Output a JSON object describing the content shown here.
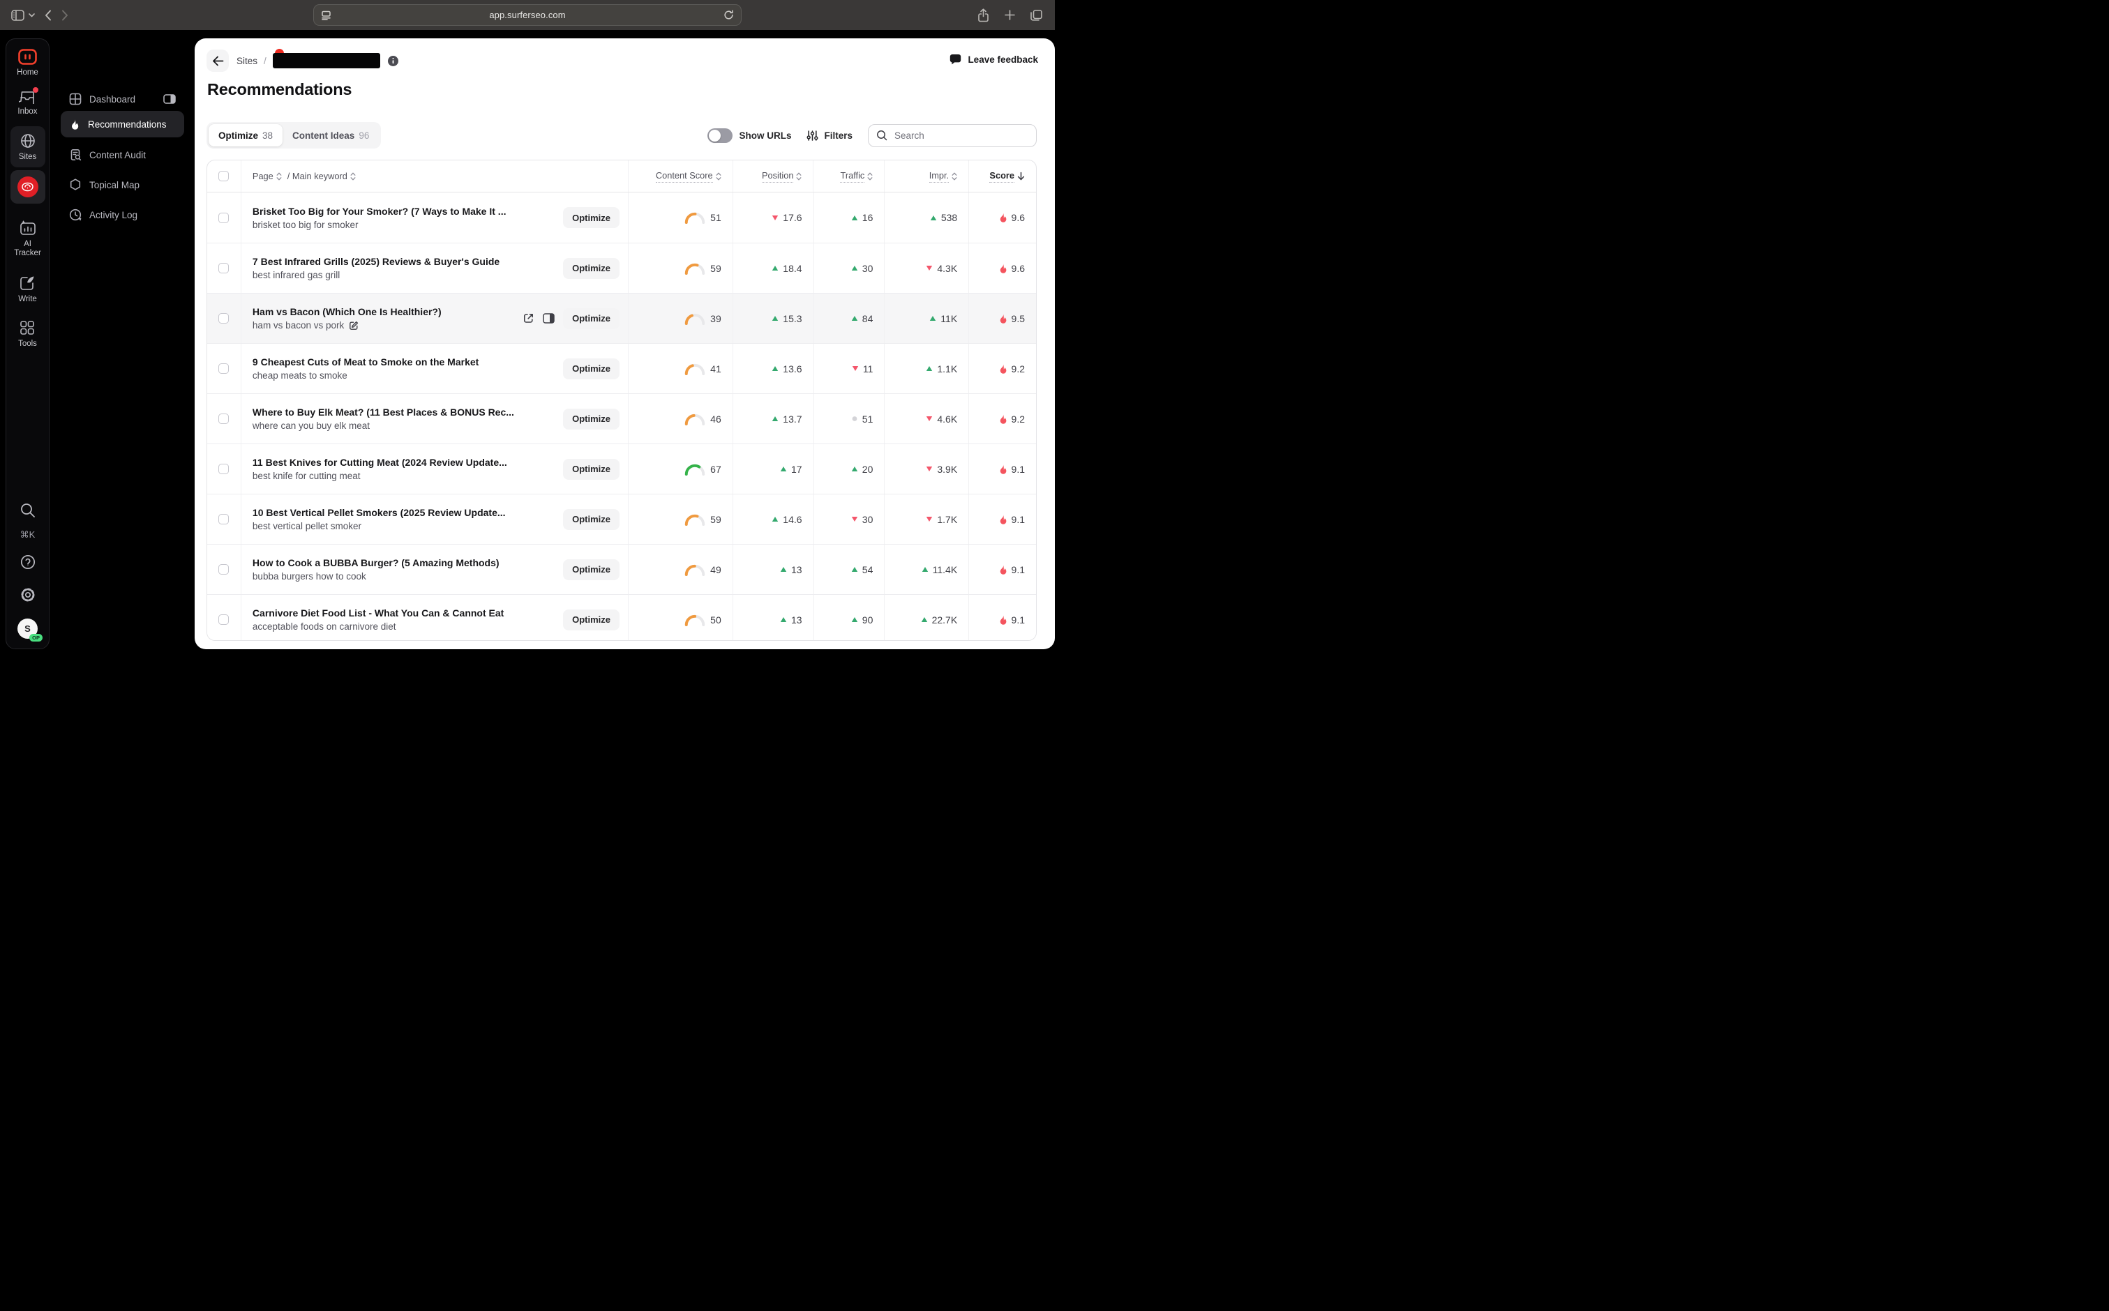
{
  "browser": {
    "url": "app.surferseo.com"
  },
  "colors": {
    "accent_red": "#e01f26",
    "gauge_orange": "#f09a3f",
    "gauge_green": "#35b34a",
    "gauge_track": "#e8e8ea",
    "up_green": "#34a96e",
    "down_red": "#f4566b",
    "neutral_gray": "#d4d4d8",
    "flame_red": "#f4545e"
  },
  "rail": {
    "items": [
      {
        "icon": "surfer-logo",
        "label": "Home"
      },
      {
        "icon": "inbox",
        "label": "Inbox",
        "badge": true
      },
      {
        "icon": "globe",
        "label": "Sites",
        "active": true
      },
      {
        "icon": "steak",
        "label": ""
      },
      {
        "icon": "ai-tracker",
        "label": "AI Tracker"
      },
      {
        "icon": "write",
        "label": "Write"
      },
      {
        "icon": "tools",
        "label": "Tools"
      }
    ],
    "shortcut": "⌘K",
    "avatar_initial": "S",
    "avatar_badge": "OP"
  },
  "nav": {
    "items": [
      {
        "icon": "dashboard",
        "label": "Dashboard",
        "trailing_icon": "panel-toggle"
      },
      {
        "icon": "flame",
        "label": "Recommendations",
        "active": true
      },
      {
        "icon": "content-audit",
        "label": "Content Audit"
      },
      {
        "icon": "hexagon",
        "label": "Topical Map"
      },
      {
        "icon": "activity",
        "label": "Activity Log"
      }
    ]
  },
  "header": {
    "breadcrumb_root": "Sites",
    "breadcrumb_separator": "/",
    "feedback_label": "Leave feedback"
  },
  "page": {
    "title": "Recommendations"
  },
  "tabs": {
    "optimize": {
      "label": "Optimize",
      "count": "38"
    },
    "content_ideas": {
      "label": "Content Ideas",
      "count": "96"
    }
  },
  "controls": {
    "show_urls_label": "Show URLs",
    "filters_label": "Filters",
    "search_placeholder": "Search"
  },
  "table": {
    "headers": {
      "page": "Page",
      "main_keyword": "/ Main keyword",
      "content_score": "Content Score",
      "position": "Position",
      "traffic": "Traffic",
      "impressions": "Impr.",
      "score": "Score"
    },
    "row_button_label": "Optimize",
    "rows": [
      {
        "title": "Brisket Too Big for Your Smoker? (7 Ways to Make It ...",
        "keyword": "brisket too big for smoker",
        "content_score": 51,
        "position": {
          "value": "17.6",
          "trend": "down"
        },
        "traffic": {
          "value": "16",
          "trend": "up"
        },
        "impressions": {
          "value": "538",
          "trend": "up"
        },
        "score": "9.6"
      },
      {
        "title": "7 Best Infrared Grills (2025) Reviews & Buyer's Guide",
        "keyword": "best infrared gas grill",
        "content_score": 59,
        "position": {
          "value": "18.4",
          "trend": "up"
        },
        "traffic": {
          "value": "30",
          "trend": "up"
        },
        "impressions": {
          "value": "4.3K",
          "trend": "down"
        },
        "score": "9.6"
      },
      {
        "title": "Ham vs Bacon (Which One Is Healthier?)",
        "keyword": "ham vs bacon vs pork",
        "keyword_edit": true,
        "hovered": true,
        "content_score": 39,
        "position": {
          "value": "15.3",
          "trend": "up"
        },
        "traffic": {
          "value": "84",
          "trend": "up"
        },
        "impressions": {
          "value": "11K",
          "trend": "up"
        },
        "score": "9.5"
      },
      {
        "title": "9 Cheapest Cuts of Meat to Smoke on the Market",
        "keyword": "cheap meats to smoke",
        "content_score": 41,
        "position": {
          "value": "13.6",
          "trend": "up"
        },
        "traffic": {
          "value": "11",
          "trend": "down"
        },
        "impressions": {
          "value": "1.1K",
          "trend": "up"
        },
        "score": "9.2"
      },
      {
        "title": "Where to Buy Elk Meat? (11 Best Places & BONUS Rec...",
        "keyword": "where can you buy elk meat",
        "content_score": 46,
        "position": {
          "value": "13.7",
          "trend": "up"
        },
        "traffic": {
          "value": "51",
          "trend": "dot"
        },
        "impressions": {
          "value": "4.6K",
          "trend": "down"
        },
        "score": "9.2"
      },
      {
        "title": "11 Best Knives for Cutting Meat (2024 Review Update...",
        "keyword": "best knife for cutting meat",
        "content_score": 67,
        "position": {
          "value": "17",
          "trend": "up"
        },
        "traffic": {
          "value": "20",
          "trend": "up"
        },
        "impressions": {
          "value": "3.9K",
          "trend": "down"
        },
        "score": "9.1"
      },
      {
        "title": "10 Best Vertical Pellet Smokers (2025 Review Update...",
        "keyword": "best vertical pellet smoker",
        "content_score": 59,
        "position": {
          "value": "14.6",
          "trend": "up"
        },
        "traffic": {
          "value": "30",
          "trend": "down"
        },
        "impressions": {
          "value": "1.7K",
          "trend": "down"
        },
        "score": "9.1"
      },
      {
        "title": "How to Cook a BUBBA Burger? (5 Amazing Methods)",
        "keyword": "bubba burgers how to cook",
        "content_score": 49,
        "position": {
          "value": "13",
          "trend": "up"
        },
        "traffic": {
          "value": "54",
          "trend": "up"
        },
        "impressions": {
          "value": "11.4K",
          "trend": "up"
        },
        "score": "9.1"
      },
      {
        "title": "Carnivore Diet Food List - What You Can & Cannot Eat",
        "keyword": "acceptable foods on carnivore diet",
        "content_score": 50,
        "position": {
          "value": "13",
          "trend": "up"
        },
        "traffic": {
          "value": "90",
          "trend": "up"
        },
        "impressions": {
          "value": "22.7K",
          "trend": "up"
        },
        "score": "9.1"
      }
    ]
  }
}
